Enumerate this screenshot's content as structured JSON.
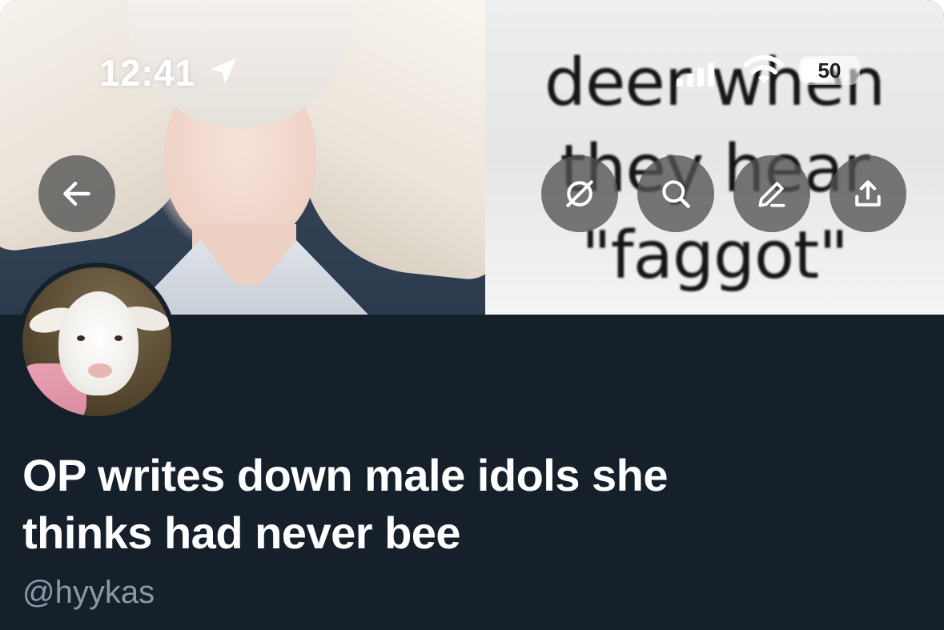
{
  "status_bar": {
    "time": "12:41",
    "battery_percent": "50",
    "battery_level": 0.5,
    "location_icon": "location-arrow-icon",
    "signal_icon": "cellular-signal-icon",
    "wifi_icon": "wifi-icon"
  },
  "banner": {
    "meme_text": "deer when\nthey hear\n\"faggot\""
  },
  "header_buttons": {
    "back": "back-arrow-icon",
    "hide_replies": "slashed-circle-icon",
    "search": "search-icon",
    "edit": "edit-pencil-icon",
    "share": "share-icon"
  },
  "list": {
    "title": "OP writes down male idols she thinks had never bee",
    "handle": "@hyykas"
  },
  "colors": {
    "background": "#15202b",
    "handle": "#8b98a5",
    "button_fill": "#525252"
  }
}
